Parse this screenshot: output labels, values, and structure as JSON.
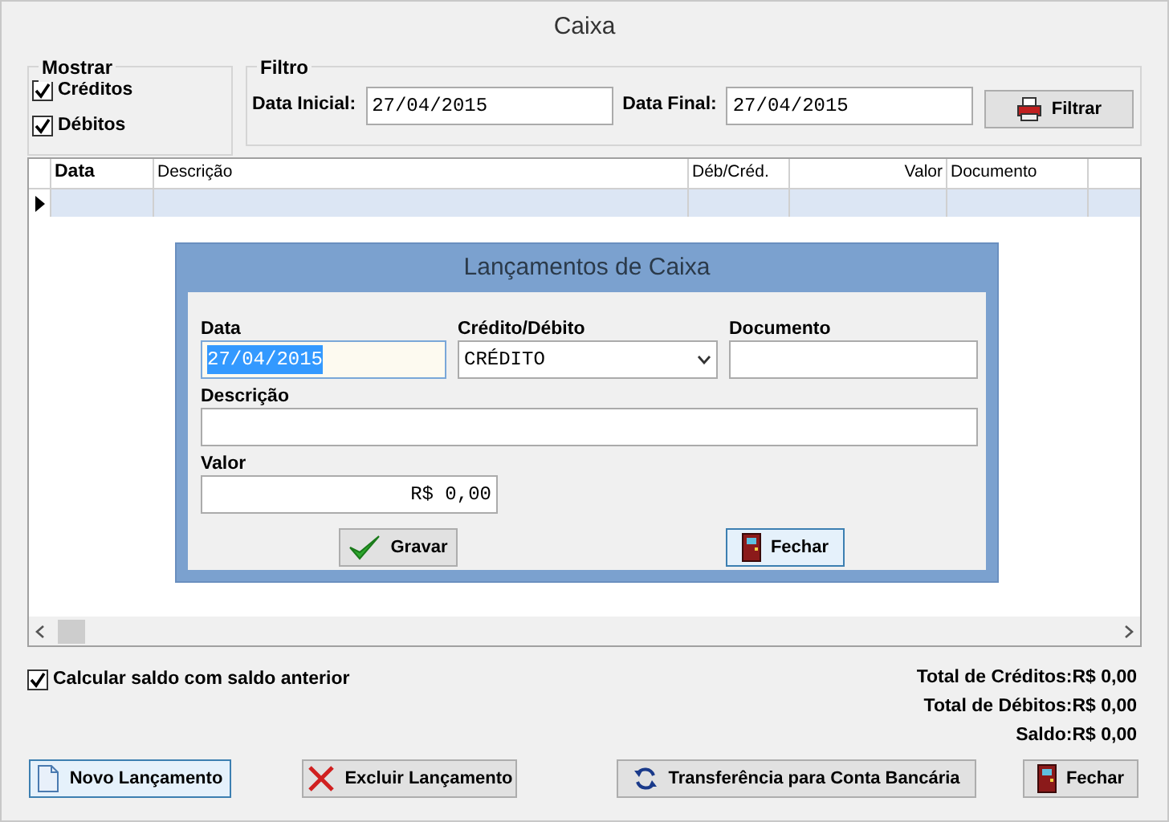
{
  "window": {
    "title": "Caixa"
  },
  "mostrar": {
    "legend": "Mostrar",
    "options": [
      {
        "label": "Créditos",
        "checked": true
      },
      {
        "label": "Débitos",
        "checked": true
      }
    ]
  },
  "filtro": {
    "legend": "Filtro",
    "fields": [
      {
        "label": "Data Inicial:",
        "value": "27/04/2015"
      },
      {
        "label": "Data Final:",
        "value": "27/04/2015"
      }
    ],
    "button": {
      "label": "Filtrar"
    }
  },
  "table": {
    "columns": [
      {
        "label": "Data"
      },
      {
        "label": "Descrição"
      },
      {
        "label": "Déb/Créd."
      },
      {
        "label": "Valor"
      },
      {
        "label": "Documento"
      }
    ],
    "rows": [
      {
        "selected": true
      }
    ]
  },
  "dialog": {
    "title": "Lançamentos de Caixa",
    "fields": [
      {
        "kind": "text",
        "label": "Data",
        "value": "27/04/2015",
        "focused": true
      },
      {
        "kind": "select",
        "label": "Crédito/Débito",
        "value": "CRÉDITO",
        "focused": false
      },
      {
        "kind": "text",
        "label": "Documento",
        "focused": false
      },
      {
        "kind": "text",
        "label": "Descrição",
        "focused": false
      },
      {
        "kind": "money",
        "label": "Valor",
        "value": "R$ 0,00",
        "focused": false
      }
    ],
    "buttons": [
      {
        "label": "Gravar",
        "default": false
      },
      {
        "label": "Fechar",
        "default": true
      }
    ]
  },
  "calc": {
    "label": "Calcular saldo com saldo anterior",
    "checked": true
  },
  "totals": [
    {
      "label": "Total de Créditos:",
      "value": "R$ 0,00"
    },
    {
      "label": "Total de Débitos:",
      "value": "R$ 0,00"
    },
    {
      "label": "Saldo:",
      "value": "R$ 0,00"
    }
  ],
  "buttons": [
    {
      "label": "Novo Lançamento",
      "default": true
    },
    {
      "label": "Excluir Lançamento",
      "default": false
    },
    {
      "label": "Transferência para Conta Bancária",
      "default": false
    },
    {
      "label": "Fechar",
      "default": false
    }
  ]
}
